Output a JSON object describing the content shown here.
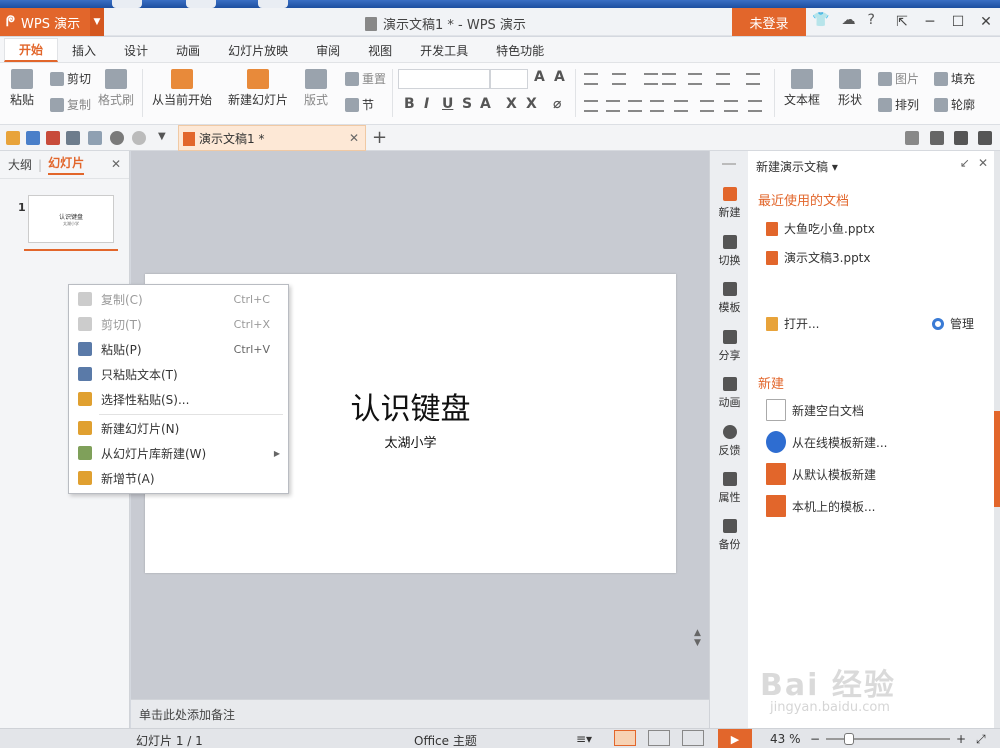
{
  "titlebar": {
    "app_name": "WPS 演示",
    "doc_title": "演示文稿1 * - WPS 演示",
    "login_label": "未登录"
  },
  "ribbon_tabs": [
    "开始",
    "插入",
    "设计",
    "动画",
    "幻灯片放映",
    "审阅",
    "视图",
    "开发工具",
    "特色功能"
  ],
  "ribbon": {
    "paste": "粘贴",
    "cut": "剪切",
    "copy": "复制",
    "format_painter": "格式刷",
    "from_current": "从当前开始",
    "new_slide": "新建幻灯片",
    "layout": "版式",
    "reset": "重置",
    "section": "节",
    "textbox": "文本框",
    "shape": "形状",
    "picture": "图片",
    "fill": "填充",
    "arrange": "排列",
    "outline": "轮廓"
  },
  "doc_tab": {
    "label": "演示文稿1 *"
  },
  "left_panel": {
    "tab_outline": "大纲",
    "tab_slides": "幻灯片",
    "slide_number": "1"
  },
  "slide": {
    "title": "认识键盘",
    "subtitle": "太湖小学"
  },
  "notes_placeholder": "单击此处添加备注",
  "context_menu": {
    "items": [
      {
        "label": "复制(C)",
        "shortcut": "Ctrl+C",
        "disabled": true
      },
      {
        "label": "剪切(T)",
        "shortcut": "Ctrl+X",
        "disabled": true
      },
      {
        "label": "粘贴(P)",
        "shortcut": "Ctrl+V",
        "disabled": false
      },
      {
        "label": "只粘贴文本(T)",
        "shortcut": "",
        "disabled": false
      },
      {
        "label": "选择性粘贴(S)...",
        "shortcut": "",
        "disabled": false
      },
      {
        "label": "新建幻灯片(N)",
        "shortcut": "",
        "disabled": false
      },
      {
        "label": "从幻灯片库新建(W)",
        "shortcut": "",
        "disabled": false,
        "submenu": true
      },
      {
        "label": "新增节(A)",
        "shortcut": "",
        "disabled": false
      }
    ]
  },
  "side_icons": [
    "新建",
    "切换",
    "模板",
    "分享",
    "动画",
    "反馈",
    "属性",
    "备份"
  ],
  "task_pane": {
    "header": "新建演示文稿",
    "recent_title": "最近使用的文档",
    "recent_docs": [
      "大鱼吃小鱼.pptx",
      "演示文稿3.pptx"
    ],
    "open_label": "打开...",
    "manage_label": "管理",
    "new_title": "新建",
    "new_items": [
      "新建空白文档",
      "从在线模板新建...",
      "从默认模板新建",
      "本机上的模板..."
    ]
  },
  "statusbar": {
    "slide_info": "幻灯片 1 / 1",
    "theme": "Office 主题",
    "zoom": "43 %"
  },
  "watermark": {
    "logo": "Bai 经验",
    "url": "jingyan.baidu.com"
  },
  "colors": {
    "accent": "#e2662b"
  }
}
